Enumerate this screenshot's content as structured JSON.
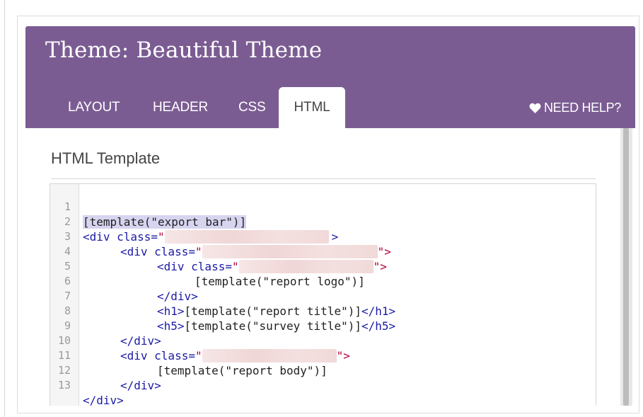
{
  "theme": {
    "title": "Theme: Beautiful Theme",
    "header_color": "#7b5c92"
  },
  "tabs": [
    {
      "label": "LAYOUT",
      "active": false
    },
    {
      "label": "HEADER",
      "active": false
    },
    {
      "label": "CSS",
      "active": false
    },
    {
      "label": "HTML",
      "active": true
    }
  ],
  "help": {
    "label": "NEED HELP?",
    "icon": "heart-icon"
  },
  "content": {
    "title": "HTML Template"
  },
  "editor": {
    "lines": [
      {
        "n": "1",
        "a": "[template(\"export bar\")]"
      },
      {
        "n": "2",
        "a": "<div",
        "b": " class=",
        "c": "\"",
        "d": ">"
      },
      {
        "n": "3",
        "a": "<div",
        "b": " class=",
        "c": "\"",
        "d": "\">"
      },
      {
        "n": "4",
        "a": "<div",
        "b": " class=",
        "c": "\"",
        "d": "\">"
      },
      {
        "n": "5",
        "a": "[template(\"report logo\")]"
      },
      {
        "n": "6",
        "a": "</div>"
      },
      {
        "n": "7",
        "a": "<h1>",
        "b": "[template(\"report title\")]",
        "c": "</h1>"
      },
      {
        "n": "8",
        "a": "<h5>",
        "b": "[template(\"survey title\")]",
        "c": "</h5>"
      },
      {
        "n": "9",
        "a": "</div>"
      },
      {
        "n": "10",
        "a": "<div",
        "b": " class=",
        "c": "\"",
        "d": "\">"
      },
      {
        "n": "11",
        "a": "[template(\"report body\")]"
      },
      {
        "n": "12",
        "a": "</div>"
      },
      {
        "n": "13",
        "a": "</div>"
      }
    ]
  }
}
